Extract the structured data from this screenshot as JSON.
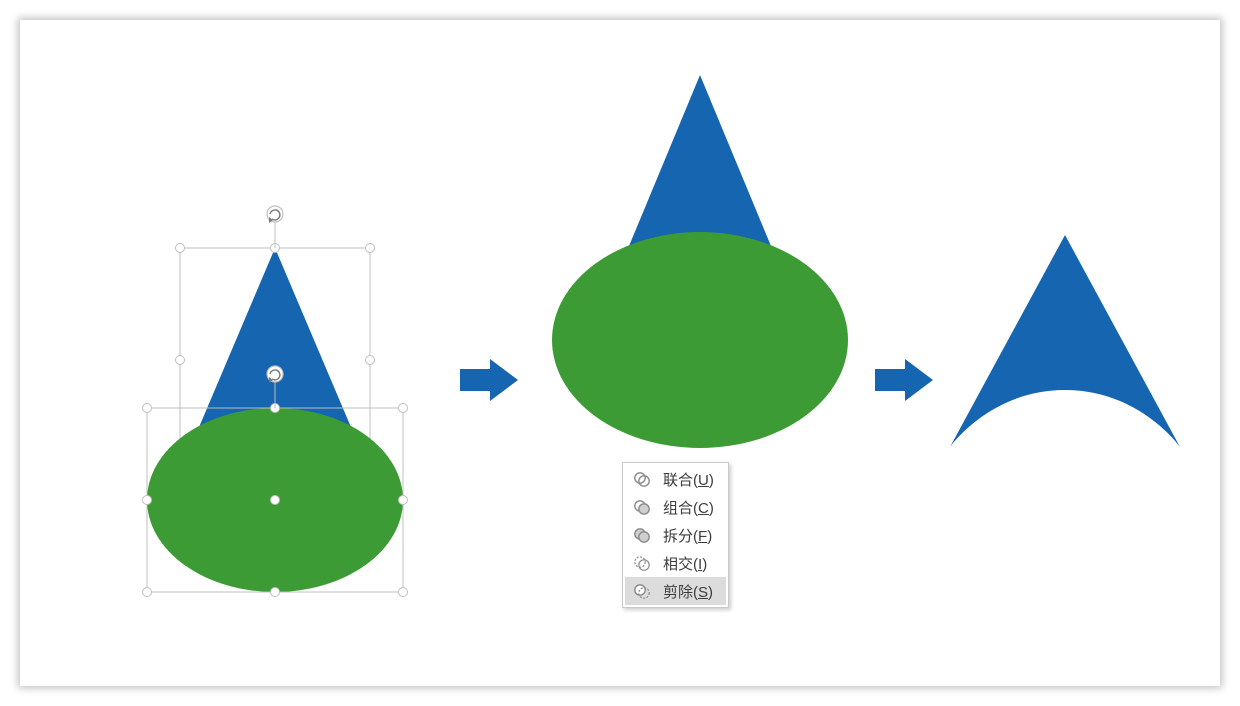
{
  "colors": {
    "blue": "#1565b0",
    "green": "#3d9b35"
  },
  "menu": {
    "items": [
      {
        "label": "联合",
        "accel": "U",
        "icon": "union-icon",
        "selected": false
      },
      {
        "label": "组合",
        "accel": "C",
        "icon": "combine-icon",
        "selected": false
      },
      {
        "label": "拆分",
        "accel": "F",
        "icon": "fragment-icon",
        "selected": false
      },
      {
        "label": "相交",
        "accel": "I",
        "icon": "intersect-icon",
        "selected": false
      },
      {
        "label": "剪除",
        "accel": "S",
        "icon": "subtract-icon",
        "selected": true
      }
    ]
  },
  "steps": [
    {
      "name": "selected-shapes",
      "desc": "triangle+ellipse selected"
    },
    {
      "name": "overlap-preview",
      "desc": "triangle behind ellipse"
    },
    {
      "name": "subtract-result",
      "desc": "triangle minus ellipse"
    }
  ]
}
